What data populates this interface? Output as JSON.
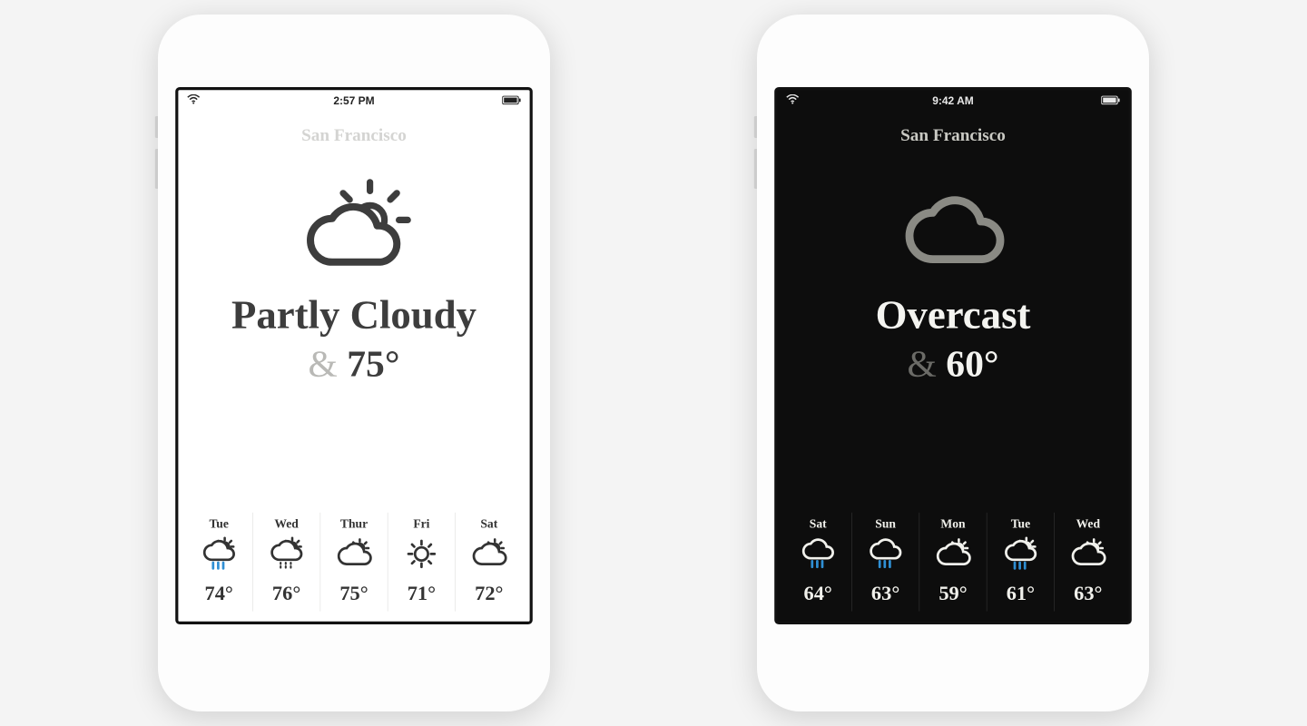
{
  "phones": [
    {
      "theme": "light",
      "status": {
        "time": "2:57 PM"
      },
      "city": "San Francisco",
      "current": {
        "condition": "Partly Cloudy",
        "amp": "&",
        "temp": "75°",
        "icon": "partly-cloudy"
      },
      "forecast": [
        {
          "day": "Tue",
          "icon": "rain-sun",
          "temp": "74°"
        },
        {
          "day": "Wed",
          "icon": "sleet-sun",
          "temp": "76°"
        },
        {
          "day": "Thur",
          "icon": "partly-cloudy",
          "temp": "75°"
        },
        {
          "day": "Fri",
          "icon": "sunny",
          "temp": "71°"
        },
        {
          "day": "Sat",
          "icon": "partly-cloudy",
          "temp": "72°"
        }
      ]
    },
    {
      "theme": "dark",
      "status": {
        "time": "9:42 AM"
      },
      "city": "San Francisco",
      "current": {
        "condition": "Overcast",
        "amp": "&",
        "temp": "60°",
        "icon": "cloud"
      },
      "forecast": [
        {
          "day": "Sat",
          "icon": "rain",
          "temp": "64°"
        },
        {
          "day": "Sun",
          "icon": "rain",
          "temp": "63°"
        },
        {
          "day": "Mon",
          "icon": "partly-cloudy",
          "temp": "59°"
        },
        {
          "day": "Tue",
          "icon": "rain-sun",
          "temp": "61°"
        },
        {
          "day": "Wed",
          "icon": "partly-cloudy",
          "temp": "63°"
        }
      ]
    }
  ],
  "colors": {
    "rain": "#2f8fd4"
  }
}
